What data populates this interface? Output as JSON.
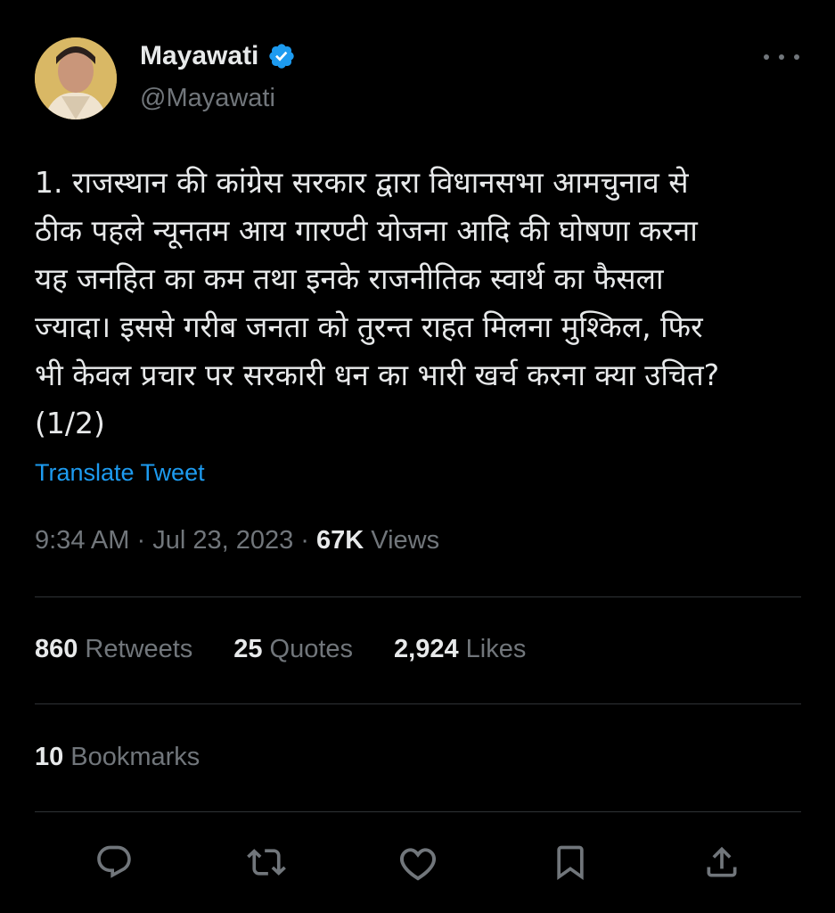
{
  "author": {
    "name": "Mayawati",
    "handle": "@Mayawati",
    "verified": true
  },
  "tweet": {
    "text": "1. राजस्थान की कांग्रेस सरकार द्वारा विधानसभा आमचुनाव से\nठीक पहले न्यूनतम आय गारण्टी योजना आदि की घोषणा करना\nयह जनहित का कम तथा इनके राजनीतिक स्वार्थ का फैसला\nज्यादा। इससे गरीब जनता को तुरन्त राहत मिलना मुश्किल, फिर\nभी केवल प्रचार पर सरकारी धन का भारी खर्च करना क्या उचित?\n(1/2)",
    "translate_label": "Translate Tweet",
    "time": "9:34 AM",
    "separator": "·",
    "date": "Jul 23, 2023",
    "views_count": "67K",
    "views_label": "Views"
  },
  "stats": {
    "retweets_count": "860",
    "retweets_label": "Retweets",
    "quotes_count": "25",
    "quotes_label": "Quotes",
    "likes_count": "2,924",
    "likes_label": "Likes",
    "bookmarks_count": "10",
    "bookmarks_label": "Bookmarks"
  },
  "actions": [
    "reply-icon",
    "retweet-icon",
    "like-icon",
    "bookmark-icon",
    "share-icon"
  ],
  "colors": {
    "background": "#000000",
    "text": "#e7e9ea",
    "secondary": "#71767b",
    "link": "#1d9bf0",
    "divider": "#2f3336"
  }
}
